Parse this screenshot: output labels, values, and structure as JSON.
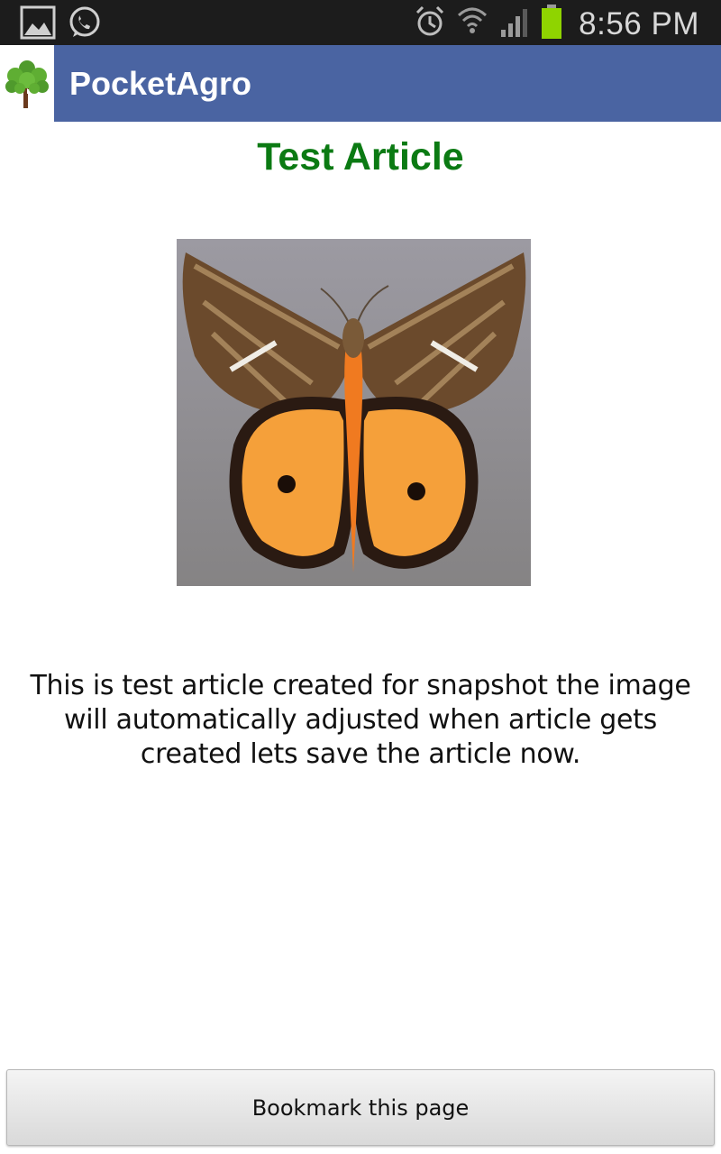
{
  "status_bar": {
    "time": "8:56 PM",
    "left_icons": [
      "gallery-icon",
      "whatsapp-icon"
    ],
    "right_icons": [
      "alarm-icon",
      "wifi-icon",
      "signal-icon",
      "battery-icon"
    ],
    "battery_color": "#8fd400"
  },
  "action_bar": {
    "app_title": "PocketAgro",
    "background": "#4a64a2",
    "logo_icon": "tree-icon"
  },
  "article": {
    "title": "Test Article",
    "title_color": "#0b7a13",
    "image_subject": "moth-image",
    "body": "This is test article created for snapshot the image will automatically adjusted when article gets created lets save the article now."
  },
  "footer": {
    "bookmark_label": "Bookmark this page"
  }
}
